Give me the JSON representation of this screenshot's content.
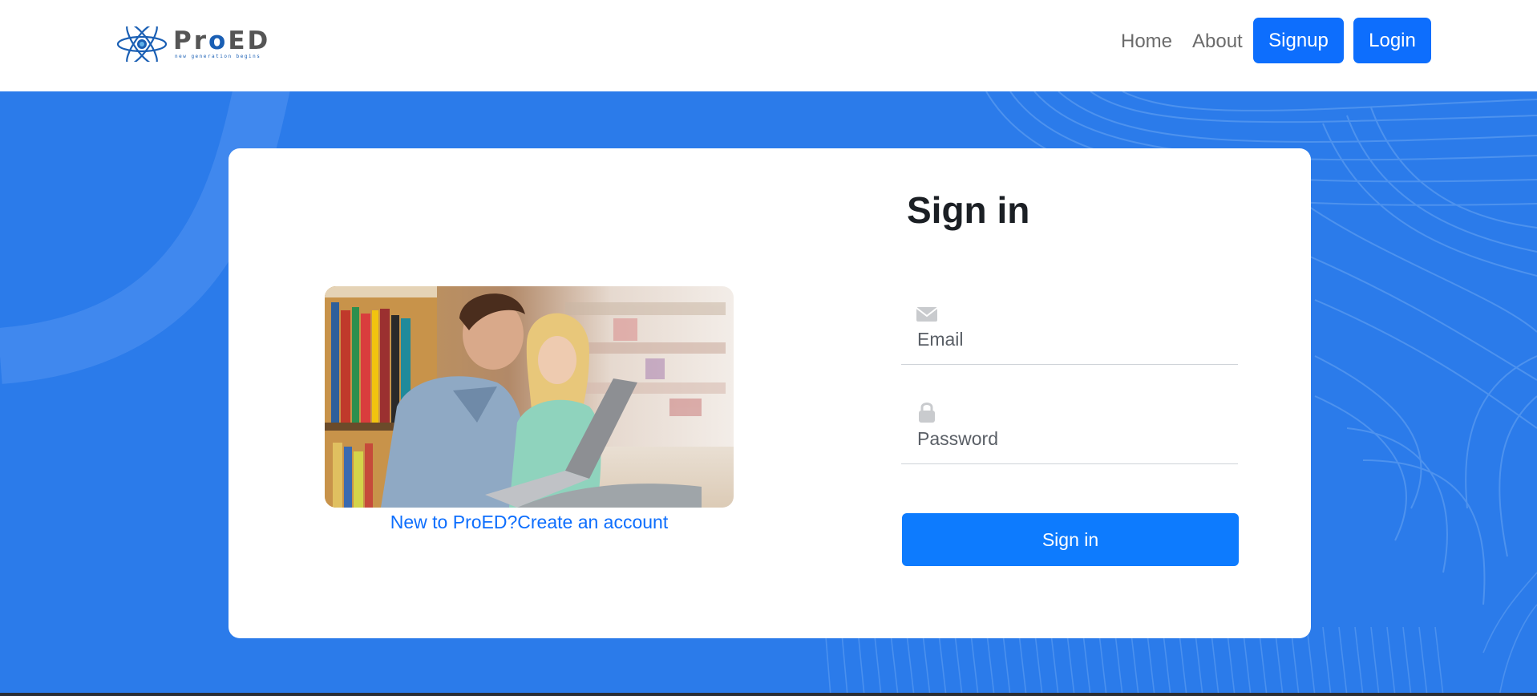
{
  "navbar": {
    "brand": {
      "text_pre": "Pr",
      "text_o": "o",
      "text_post": "ED",
      "tagline": "new generation begins",
      "icon": "atom-logo-icon"
    },
    "links": {
      "home": "Home",
      "about": "About"
    },
    "buttons": {
      "signup": "Signup",
      "login": "Login"
    },
    "colors": {
      "button_bg": "#0d6efd",
      "link": "#6b6b6b"
    }
  },
  "hero": {
    "background": "#2b7bea"
  },
  "signin": {
    "title": "Sign in",
    "email": {
      "placeholder": "Email",
      "icon": "envelope-icon"
    },
    "password": {
      "placeholder": "Password",
      "icon": "lock-icon"
    },
    "submit_label": "Sign in",
    "create_account": {
      "prefix": "New to ProED?",
      "link": "Create an account"
    }
  }
}
